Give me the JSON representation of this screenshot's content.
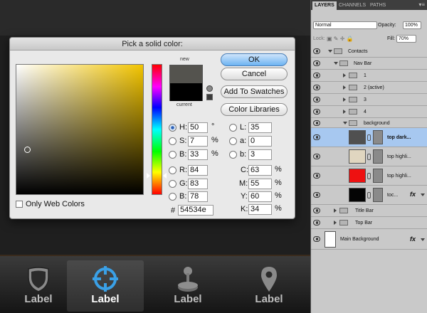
{
  "dialog": {
    "title": "Pick a solid color:",
    "new_label": "new",
    "current_label": "current",
    "buttons": {
      "ok": "OK",
      "cancel": "Cancel",
      "add_to_swatches": "Add To Swatches",
      "color_libraries": "Color Libraries"
    },
    "fields": {
      "H": {
        "label": "H:",
        "value": "50",
        "unit": "°"
      },
      "S": {
        "label": "S:",
        "value": "7",
        "unit": "%"
      },
      "B": {
        "label": "B:",
        "value": "33",
        "unit": "%"
      },
      "R": {
        "label": "R:",
        "value": "84"
      },
      "G": {
        "label": "G:",
        "value": "83"
      },
      "Bl": {
        "label": "B:",
        "value": "78"
      },
      "L": {
        "label": "L:",
        "value": "35"
      },
      "a": {
        "label": "a:",
        "value": "0"
      },
      "b": {
        "label": "b:",
        "value": "3"
      },
      "C": {
        "label": "C:",
        "value": "63",
        "unit": "%"
      },
      "M": {
        "label": "M:",
        "value": "55",
        "unit": "%"
      },
      "Y": {
        "label": "Y:",
        "value": "60",
        "unit": "%"
      },
      "K": {
        "label": "K:",
        "value": "34",
        "unit": "%"
      }
    },
    "hex": {
      "label": "#",
      "value": "54534e"
    },
    "web_colors_label": "Only Web Colors",
    "colors": {
      "new": "#54534e",
      "current": "#000000"
    }
  },
  "tab_bar": {
    "items": [
      {
        "label": "Label",
        "icon": "shield-icon"
      },
      {
        "label": "Label",
        "icon": "crosshair-icon",
        "selected": true
      },
      {
        "label": "Label",
        "icon": "joystick-icon"
      },
      {
        "label": "Label",
        "icon": "map-pin-icon"
      }
    ]
  },
  "layers_panel": {
    "tabs": [
      "LAYERS",
      "CHANNELS",
      "PATHS"
    ],
    "blend_mode": "Normal",
    "opacity_label": "Opacity:",
    "opacity": "100%",
    "lock_label": "Lock:",
    "fill_label": "Fill:",
    "fill": "70%",
    "layers": [
      {
        "name": "Contacts",
        "type": "group"
      },
      {
        "name": "Nav Bar",
        "type": "group"
      },
      {
        "name": "1",
        "type": "group"
      },
      {
        "name": "2 (active)",
        "type": "group"
      },
      {
        "name": "3",
        "type": "group"
      },
      {
        "name": "4",
        "type": "group"
      },
      {
        "name": "background",
        "type": "group"
      },
      {
        "name": "top dark...",
        "type": "layer",
        "selected": true,
        "thumb": "#505050"
      },
      {
        "name": "top highli...",
        "type": "layer",
        "thumb": "#e0d6c0"
      },
      {
        "name": "top highli...",
        "type": "layer",
        "thumb": "#ee1111"
      },
      {
        "name": "toc...",
        "type": "layer",
        "thumb": "#050505",
        "fx": "fx"
      },
      {
        "name": "Title Bar",
        "type": "group"
      },
      {
        "name": "Top Bar",
        "type": "group"
      },
      {
        "name": "Main Background",
        "type": "layer",
        "thumb": "#ffffff",
        "fx": "fx"
      }
    ]
  }
}
